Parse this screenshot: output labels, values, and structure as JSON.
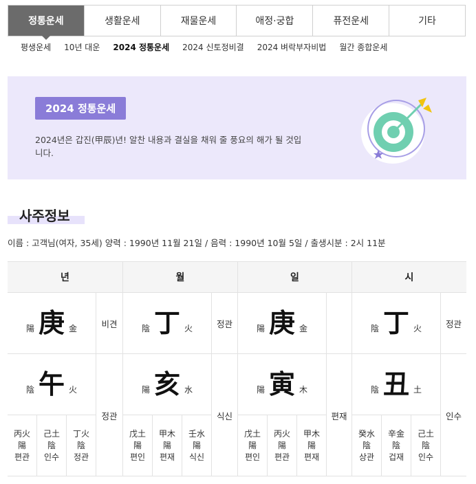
{
  "main_tabs": [
    "정통운세",
    "생활운세",
    "재물운세",
    "애정·궁합",
    "퓨전운세",
    "기타"
  ],
  "sub_tabs": [
    "평생운세",
    "10년 대운",
    "2024 정통운세",
    "2024 신토정비결",
    "2024 벼락부자비법",
    "월간 종합운세"
  ],
  "active_sub_tab": 2,
  "banner": {
    "badge": "2024 정통운세",
    "description": "2024년은 갑진(甲辰)년! 알찬 내용과 결실을 채워 줄 풍요의 해가 될 것입니다.",
    "art_icon": "target-arrow-icon",
    "colors": {
      "background": "#ece8fb",
      "badge": "#8a7cd8",
      "target_ring": "#6fcfb0",
      "arrow": "#f1c40f",
      "star": "#8a7cd8"
    }
  },
  "section": {
    "title": "사주정보",
    "info": "이름 : 고객님(여자, 35세)   양력 : 1990년 11월 21일 / 음력 : 1990년 10월 5일 / 출생시분 : 2시 11분"
  },
  "pillars": [
    {
      "head": "년",
      "stem": {
        "yinyang": "陽",
        "char": "庚",
        "element": "金",
        "label": "비견"
      },
      "branch": {
        "yinyang": "陰",
        "char": "午",
        "element": "火",
        "label": "정관"
      },
      "hidden": [
        {
          "stem": "丙火",
          "yinyang": "陽",
          "label": "편관"
        },
        {
          "stem": "己土",
          "yinyang": "陰",
          "label": "인수"
        },
        {
          "stem": "丁火",
          "yinyang": "陰",
          "label": "정관"
        }
      ]
    },
    {
      "head": "월",
      "stem": {
        "yinyang": "陰",
        "char": "丁",
        "element": "火",
        "label": "정관"
      },
      "branch": {
        "yinyang": "陽",
        "char": "亥",
        "element": "水",
        "label": "식신"
      },
      "hidden": [
        {
          "stem": "戊土",
          "yinyang": "陽",
          "label": "편인"
        },
        {
          "stem": "甲木",
          "yinyang": "陽",
          "label": "편재"
        },
        {
          "stem": "壬水",
          "yinyang": "陽",
          "label": "식신"
        }
      ]
    },
    {
      "head": "일",
      "stem": {
        "yinyang": "陽",
        "char": "庚",
        "element": "金",
        "label": ""
      },
      "branch": {
        "yinyang": "陽",
        "char": "寅",
        "element": "木",
        "label": "편재"
      },
      "hidden": [
        {
          "stem": "戊土",
          "yinyang": "陽",
          "label": "편인"
        },
        {
          "stem": "丙火",
          "yinyang": "陽",
          "label": "편관"
        },
        {
          "stem": "甲木",
          "yinyang": "陽",
          "label": "편재"
        }
      ]
    },
    {
      "head": "시",
      "stem": {
        "yinyang": "陰",
        "char": "丁",
        "element": "火",
        "label": "정관"
      },
      "branch": {
        "yinyang": "陰",
        "char": "丑",
        "element": "土",
        "label": "인수"
      },
      "hidden": [
        {
          "stem": "癸水",
          "yinyang": "陰",
          "label": "상관"
        },
        {
          "stem": "辛金",
          "yinyang": "陰",
          "label": "겁재"
        },
        {
          "stem": "己土",
          "yinyang": "陰",
          "label": "인수"
        }
      ]
    }
  ]
}
